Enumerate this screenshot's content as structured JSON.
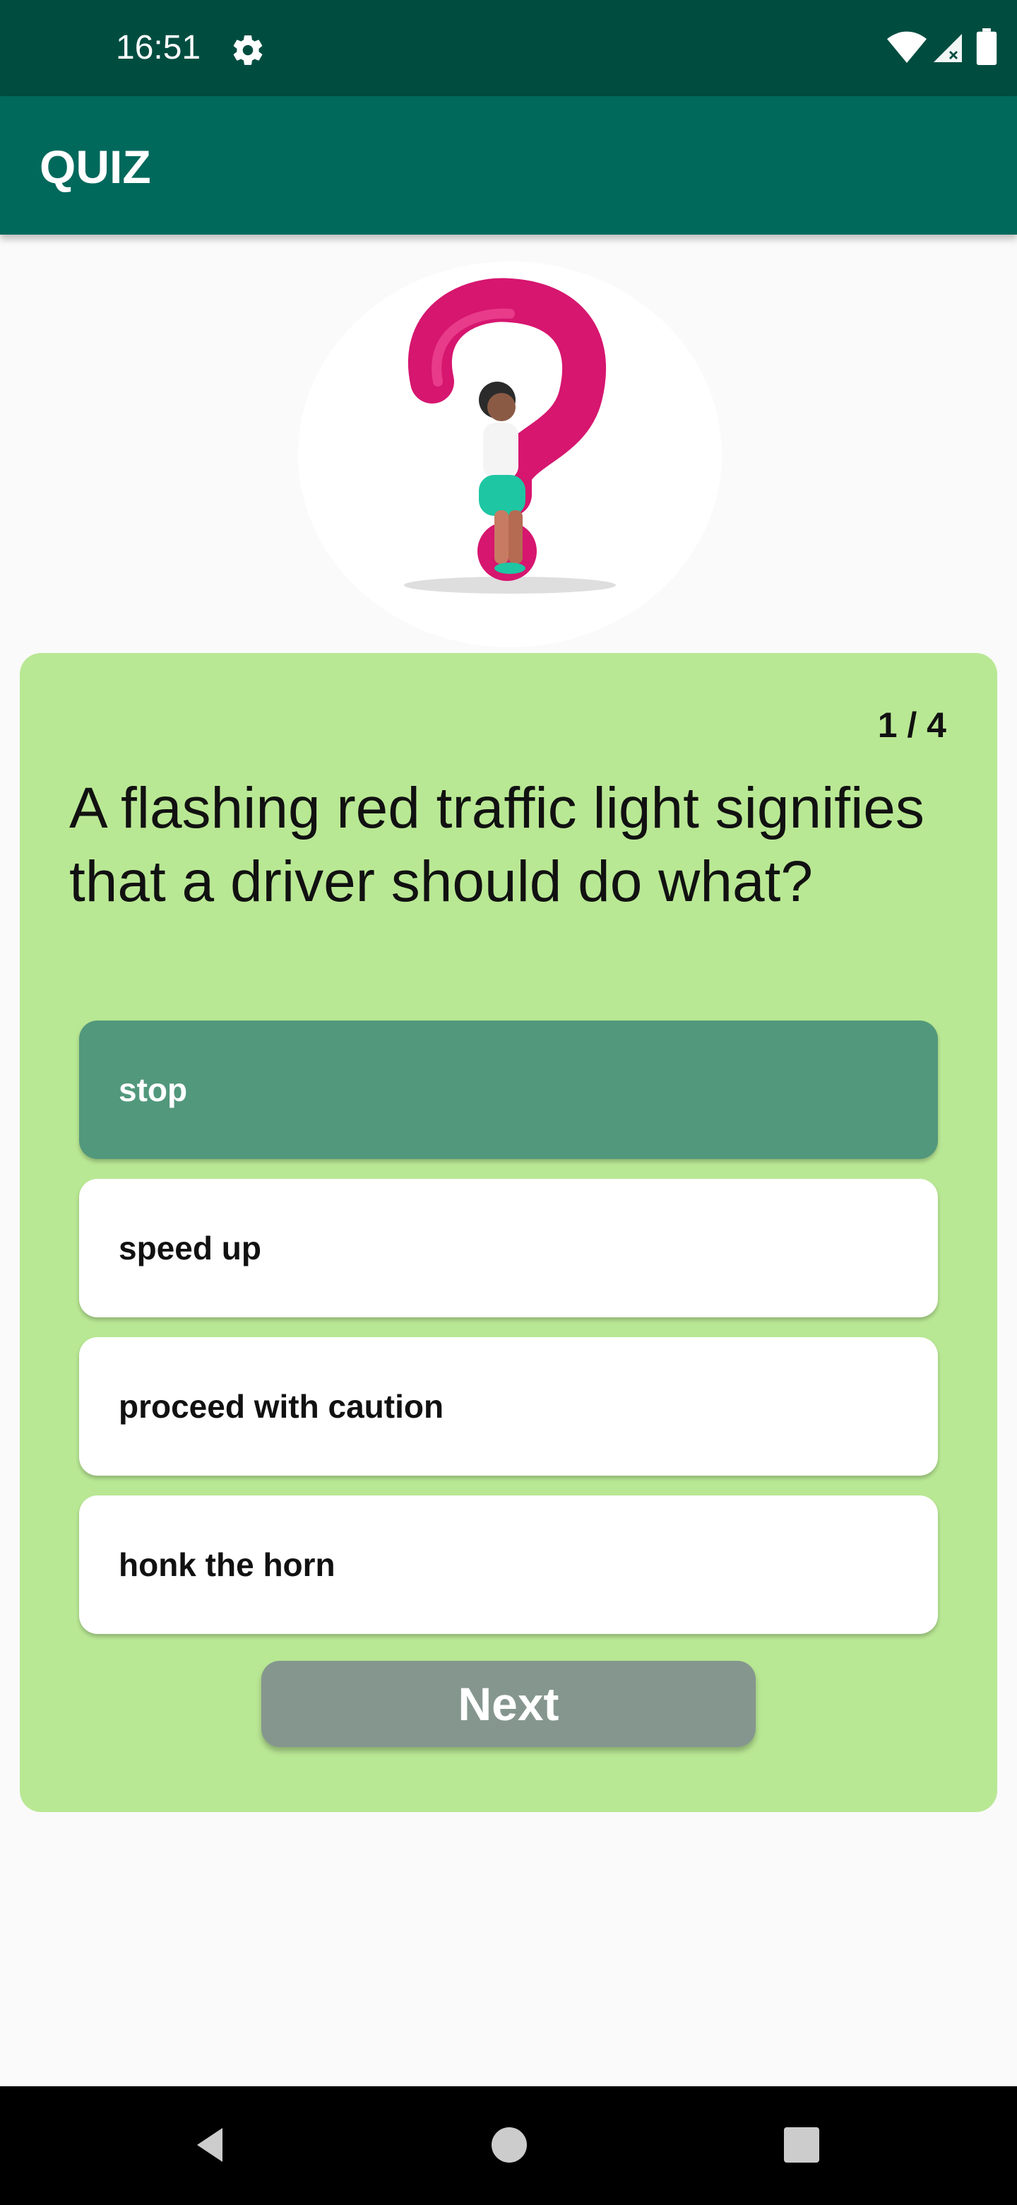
{
  "status_bar": {
    "time": "16:51",
    "icons": [
      "gear-icon",
      "wifi-icon",
      "signal-icon",
      "battery-icon"
    ]
  },
  "app_bar": {
    "title": "QUIZ",
    "color": "#00695c"
  },
  "hero": {
    "icon": "question-mark-illustration"
  },
  "quiz": {
    "progress": "1 / 4",
    "question": "A flashing red traffic light signifies that a driver should do what?",
    "options": [
      {
        "label": "stop",
        "selected": true
      },
      {
        "label": "speed up",
        "selected": false
      },
      {
        "label": "proceed with caution",
        "selected": false
      },
      {
        "label": "honk the horn",
        "selected": false
      }
    ],
    "next_label": "Next",
    "card_color": "#b9e894",
    "selected_color": "#52987c"
  },
  "nav_bar": {
    "icons": [
      "back-icon",
      "home-icon",
      "recents-icon"
    ]
  }
}
